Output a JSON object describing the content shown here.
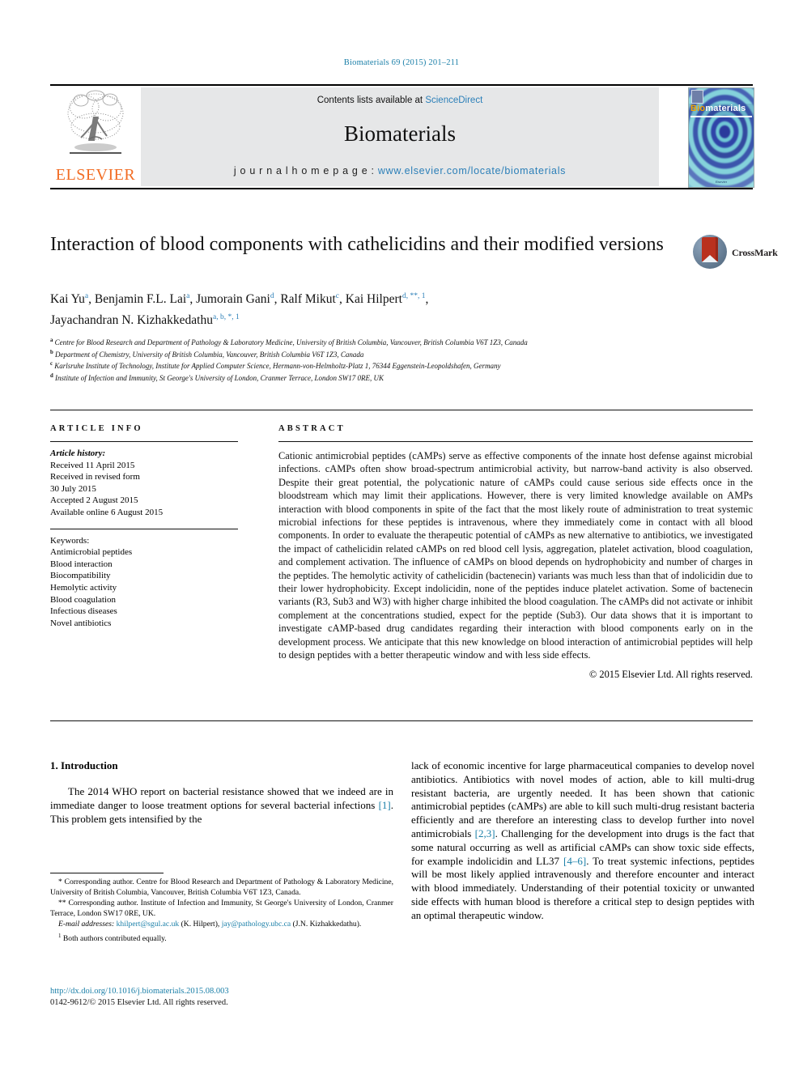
{
  "running_head": "Biomaterials 69 (2015) 201–211",
  "header": {
    "contents_prefix": "Contents lists available at ",
    "sciencedirect": "ScienceDirect",
    "journal_title": "Biomaterials",
    "homepage_prefix": "j o u r n a l   h o m e p a g e :  ",
    "homepage_url": "www.elsevier.com/locate/biomaterials",
    "publisher": "ELSEVIER",
    "cover_word_a": "Bio",
    "cover_word_b": "materials",
    "cover_footer": "Elsevier"
  },
  "article": {
    "title": "Interaction of blood components with cathelicidins and their modified versions",
    "crossmark_label": "CrossMark",
    "authors_line1_prefix": "Kai Yu ",
    "authors": [
      {
        "name": "Kai Yu",
        "sup": "a"
      },
      {
        "name": "Benjamin F.L. Lai",
        "sup": "a"
      },
      {
        "name": "Jumorain Gani",
        "sup": "d"
      },
      {
        "name": "Ralf Mikut",
        "sup": "c"
      },
      {
        "name": "Kai Hilpert",
        "sup": "d, **, 1"
      },
      {
        "name": "Jayachandran N. Kizhakkedathu",
        "sup": "a, b, *, 1"
      }
    ],
    "affiliations": [
      {
        "label": "a",
        "text": "Centre for Blood Research and Department of Pathology & Laboratory Medicine, University of British Columbia, Vancouver, British Columbia V6T 1Z3, Canada"
      },
      {
        "label": "b",
        "text": "Department of Chemistry, University of British Columbia, Vancouver, British Columbia V6T 1Z3, Canada"
      },
      {
        "label": "c",
        "text": "Karlsruhe Institute of Technology, Institute for Applied Computer Science, Hermann-von-Helmholtz-Platz 1, 76344 Eggenstein-Leopoldshafen, Germany"
      },
      {
        "label": "d",
        "text": "Institute of Infection and Immunity, St George's University of London, Cranmer Terrace, London SW17 0RE, UK"
      }
    ]
  },
  "article_info": {
    "heading": "ARTICLE INFO",
    "history_label": "Article history:",
    "history": [
      "Received 11 April 2015",
      "Received in revised form",
      "30 July 2015",
      "Accepted 2 August 2015",
      "Available online 6 August 2015"
    ],
    "keywords_label": "Keywords:",
    "keywords": [
      "Antimicrobial peptides",
      "Blood interaction",
      "Biocompatibility",
      "Hemolytic activity",
      "Blood coagulation",
      "Infectious diseases",
      "Novel antibiotics"
    ]
  },
  "abstract": {
    "heading": "ABSTRACT",
    "text": "Cationic antimicrobial peptides (cAMPs) serve as effective components of the innate host defense against microbial infections. cAMPs often show broad-spectrum antimicrobial activity, but narrow-band activity is also observed. Despite their great potential, the polycationic nature of cAMPs could cause serious side effects once in the bloodstream which may limit their applications. However, there is very limited knowledge available on AMPs interaction with blood components in spite of the fact that the most likely route of administration to treat systemic microbial infections for these peptides is intravenous, where they immediately come in contact with all blood components. In order to evaluate the therapeutic potential of cAMPs as new alternative to antibiotics, we investigated the impact of cathelicidin related cAMPs on red blood cell lysis, aggregation, platelet activation, blood coagulation, and complement activation. The influence of cAMPs on blood depends on hydrophobicity and number of charges in the peptides. The hemolytic activity of cathelicidin (bactenecin) variants was much less than that of indolicidin due to their lower hydrophobicity. Except indolicidin, none of the peptides induce platelet activation. Some of bactenecin variants (R3, Sub3 and W3) with higher charge inhibited the blood coagulation. The cAMPs did not activate or inhibit complement at the concentrations studied, expect for the peptide (Sub3). Our data shows that it is important to investigate cAMP-based drug candidates regarding their interaction with blood components early on in the development process. We anticipate that this new knowledge on blood interaction of antimicrobial peptides will help to design peptides with a better therapeutic window and with less side effects.",
    "copyright": "© 2015 Elsevier Ltd. All rights reserved."
  },
  "body": {
    "section_heading": "1. Introduction",
    "left_paragraph_pre": "The 2014 WHO report on bacterial resistance showed that we indeed are in immediate danger to loose treatment options for several bacterial infections ",
    "left_ref_1": "[1]",
    "left_paragraph_post": ". This problem gets intensified by the",
    "right_part_1": "lack of economic incentive for large pharmaceutical companies to develop novel antibiotics. Antibiotics with novel modes of action, able to kill multi-drug resistant bacteria, are urgently needed. It has been shown that cationic antimicrobial peptides (cAMPs) are able to kill such multi-drug resistant bacteria efficiently and are therefore an interesting class to develop further into novel antimicrobials ",
    "right_ref_2": "[2,3]",
    "right_part_2": ". Challenging for the development into drugs is the fact that some natural occurring as well as artificial cAMPs can show toxic side effects, for example indolicidin and LL37 ",
    "right_ref_3": "[4–6]",
    "right_part_3": ". To treat systemic infections, peptides will be most likely applied intravenously and therefore encounter and interact with blood immediately. Understanding of their potential toxicity or unwanted side effects with human blood is therefore a critical step to design peptides with an optimal therapeutic window."
  },
  "footnotes": {
    "corresponding_1": "* Corresponding author. Centre for Blood Research and Department of Pathology & Laboratory Medicine, University of British Columbia, Vancouver, British Columbia V6T 1Z3, Canada.",
    "corresponding_2": "** Corresponding author. Institute of Infection and Immunity, St George's University of London, Cranmer Terrace, London SW17 0RE, UK.",
    "email_label": "E-mail addresses:",
    "email_1": "khilpert@sgul.ac.uk",
    "email_1_owner": "(K. Hilpert)",
    "email_2": "jay@pathology.ubc.ca",
    "email_2_owner": "(J.N. Kizhakkedathu).",
    "equal_contrib_sup": "1",
    "equal_contrib": "Both authors contributed equally."
  },
  "footer": {
    "doi": "http://dx.doi.org/10.1016/j.biomaterials.2015.08.003",
    "issn": "0142-9612/© 2015 Elsevier Ltd. All rights reserved."
  },
  "colors": {
    "link": "#1a7fa8",
    "elsevier_orange": "#F26C23",
    "crossmark_red": "#b9311f",
    "header_band": "#e6e7e8"
  }
}
